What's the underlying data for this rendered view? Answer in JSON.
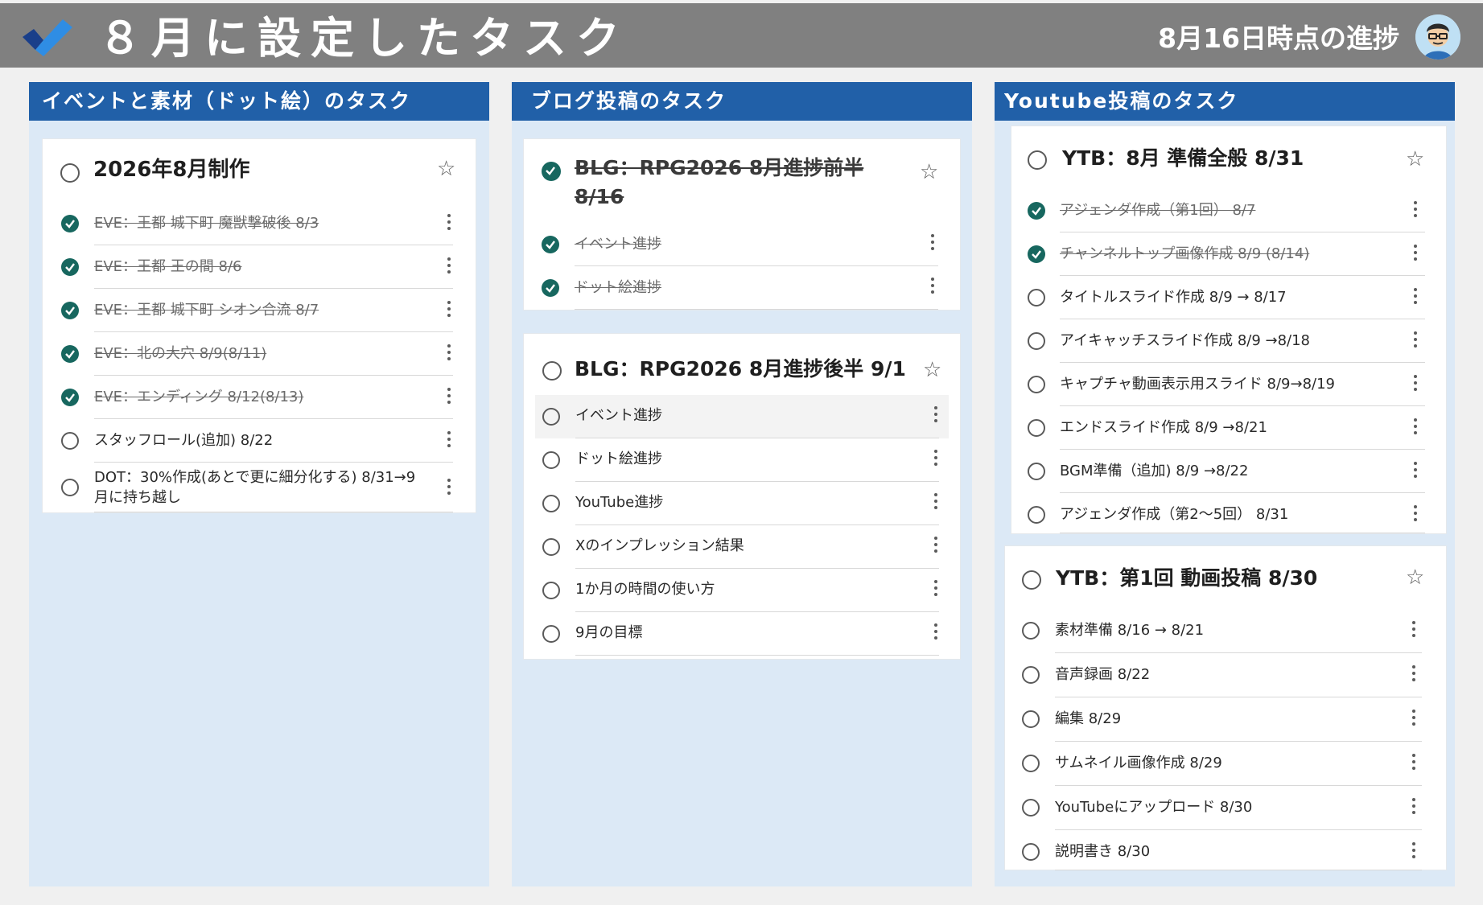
{
  "header": {
    "title": "８月に設定したタスク",
    "progress": "8月16日時点の進捗",
    "logo_icon": "checkmark-logo-icon",
    "avatar_icon": "avatar-icon",
    "bar_color": "#808080"
  },
  "colors": {
    "column_header": "#2160a8",
    "column_bg": "#dce9f6",
    "check_fill": "#17675f"
  },
  "columns": [
    {
      "title": "イベントと素材（ドット絵）のタスク",
      "cards": [
        {
          "title": "2026年8月制作",
          "done": false,
          "tasks": [
            {
              "label": "EVE：王都 城下町 魔獣撃破後 8/3",
              "done": true
            },
            {
              "label": "EVE：王都 王の間 8/6",
              "done": true
            },
            {
              "label": "EVE：王都 城下町 シオン合流 8/7",
              "done": true
            },
            {
              "label": "EVE：北の大穴 8/9(8/11)",
              "done": true
            },
            {
              "label": "EVE：エンディング 8/12(8/13)",
              "done": true
            },
            {
              "label": "スタッフロール(追加) 8/22",
              "done": false
            },
            {
              "label": "DOT：30%作成(あとで更に細分化する) 8/31→9月に持ち越し",
              "done": false
            }
          ]
        }
      ]
    },
    {
      "title": "ブログ投稿のタスク",
      "cards": [
        {
          "title": "BLG：RPG2026 8月進捗前半 8/16",
          "done": true,
          "tasks": [
            {
              "label": "イベント進捗",
              "done": true
            },
            {
              "label": "ドット絵進捗",
              "done": true
            }
          ]
        },
        {
          "title": "BLG：RPG2026 8月進捗後半 9/1",
          "done": false,
          "tasks": [
            {
              "label": "イベント進捗",
              "done": false
            },
            {
              "label": "ドット絵進捗",
              "done": false
            },
            {
              "label": "YouTube進捗",
              "done": false
            },
            {
              "label": "Xのインプレッション結果",
              "done": false
            },
            {
              "label": "1か月の時間の使い方",
              "done": false
            },
            {
              "label": "9月の目標",
              "done": false
            }
          ]
        }
      ]
    },
    {
      "title": "Youtube投稿のタスク",
      "cards": [
        {
          "title": "YTB：8月 準備全般 8/31",
          "done": false,
          "tasks": [
            {
              "label": "アジェンダ作成（第1回） 8/7",
              "done": true
            },
            {
              "label": "チャンネルトップ画像作成 8/9 (8/14)",
              "done": true
            },
            {
              "label": "タイトルスライド作成 8/9 → 8/17",
              "done": false
            },
            {
              "label": "アイキャッチスライド作成 8/9 →8/18",
              "done": false
            },
            {
              "label": "キャプチャ動画表示用スライド 8/9→8/19",
              "done": false
            },
            {
              "label": "エンドスライド作成 8/9 →8/21",
              "done": false
            },
            {
              "label": "BGM準備（追加) 8/9 →8/22",
              "done": false
            },
            {
              "label": "アジェンダ作成（第2～5回） 8/31",
              "done": false
            }
          ]
        },
        {
          "title": "YTB：第1回 動画投稿 8/30",
          "done": false,
          "tasks": [
            {
              "label": "素材準備 8/16 → 8/21",
              "done": false
            },
            {
              "label": "音声録画 8/22",
              "done": false
            },
            {
              "label": "編集 8/29",
              "done": false
            },
            {
              "label": "サムネイル画像作成 8/29",
              "done": false
            },
            {
              "label": "YouTubeにアップロード 8/30",
              "done": false
            },
            {
              "label": "説明書き 8/30",
              "done": false
            }
          ]
        }
      ]
    }
  ]
}
